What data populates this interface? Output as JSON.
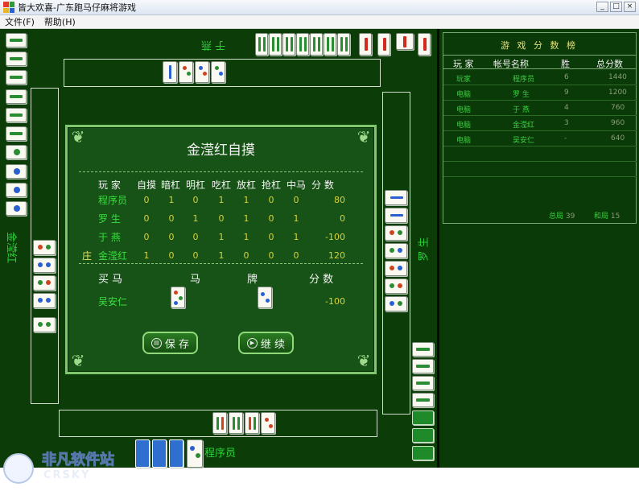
{
  "window": {
    "title": "皆大欢喜-广东跑马仔麻将游戏",
    "minimize": "_",
    "maximize": "□",
    "close": "×"
  },
  "menu": [
    "文件(F)",
    "帮助(H)"
  ],
  "seats": {
    "north": "于 燕",
    "west": "金滢红",
    "east": "罗 生",
    "south": "程序员"
  },
  "dialog": {
    "title": "金滢红自摸",
    "headers": [
      "玩 家",
      "自摸",
      "暗杠",
      "明杠",
      "吃杠",
      "放杠",
      "抢杠",
      "中马",
      "分 数"
    ],
    "rows": [
      {
        "name": "程序员",
        "vals": [
          "0",
          "1",
          "0",
          "1",
          "1",
          "0",
          "0"
        ],
        "score": "80"
      },
      {
        "name": "罗 生",
        "vals": [
          "0",
          "0",
          "1",
          "0",
          "1",
          "0",
          "1"
        ],
        "score": "0"
      },
      {
        "name": "于 燕",
        "vals": [
          "0",
          "0",
          "0",
          "1",
          "1",
          "0",
          "1"
        ],
        "score": "-100"
      },
      {
        "name": "金滢红",
        "vals": [
          "1",
          "0",
          "0",
          "1",
          "0",
          "0",
          "0"
        ],
        "score": "120"
      }
    ],
    "dealer_mark": "庄",
    "buy_headers": [
      "买 马",
      "马",
      "牌",
      "分 数"
    ],
    "buy_row": {
      "name": "吴安仁",
      "score": "-100"
    },
    "save_label": "保 存",
    "continue_label": "继 续"
  },
  "scoreboard": {
    "title": "游 戏 分 数 榜",
    "headers": [
      "玩 家",
      "帐号名称",
      "胜",
      "总分数"
    ],
    "rows": [
      {
        "type": "玩家",
        "name": "程序员",
        "wins": "6",
        "total": "1440"
      },
      {
        "type": "电脑",
        "name": "罗 生",
        "wins": "9",
        "total": "1200"
      },
      {
        "type": "电脑",
        "name": "于 燕",
        "wins": "4",
        "total": "760"
      },
      {
        "type": "电脑",
        "name": "金滢红",
        "wins": "3",
        "total": "960"
      },
      {
        "type": "电脑",
        "name": "吴安仁",
        "wins": "-",
        "total": "640"
      }
    ],
    "total_games_label": "总局",
    "total_games": "39",
    "draws_label": "和局",
    "draws": "15"
  },
  "colors": {
    "felt": "#0c3c08",
    "dialog": "#175316",
    "accent_green": "#38df3f",
    "score_yellow": "#d8d03a",
    "tile_back": "#2f6fd0"
  },
  "watermark": {
    "line1": "非凡软件站",
    "line2": "CRSKY"
  }
}
